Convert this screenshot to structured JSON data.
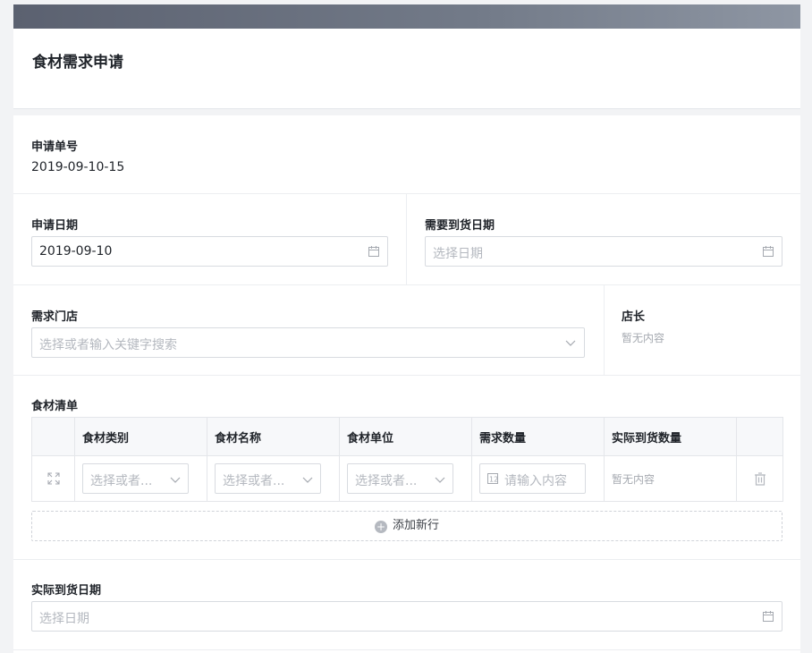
{
  "header": {
    "title": "食材需求申请"
  },
  "form": {
    "order_no": {
      "label": "申请单号",
      "value": "2019-09-10-15"
    },
    "apply_date": {
      "label": "申请日期",
      "value": "2019-09-10"
    },
    "arrive_date": {
      "label": "需要到货日期",
      "placeholder": "选择日期"
    },
    "store": {
      "label": "需求门店",
      "placeholder": "选择或者输入关键字搜索"
    },
    "manager": {
      "label": "店长",
      "value": "暂无内容"
    },
    "items": {
      "label": "食材清单",
      "columns": [
        "食材类别",
        "食材名称",
        "食材单位",
        "需求数量",
        "实际到货数量"
      ],
      "row": {
        "category_placeholder": "选择或者...",
        "name_placeholder": "选择或者...",
        "unit_placeholder": "选择或者...",
        "qty_placeholder": "请输入内容",
        "actual_qty": "暂无内容"
      },
      "add_row_label": "添加新行"
    },
    "actual_date": {
      "label": "实际到货日期",
      "placeholder": "选择日期"
    }
  },
  "colors": {
    "accent_bar": "#737b89",
    "border": "#d8dbe0",
    "placeholder": "#b4b8bf"
  }
}
